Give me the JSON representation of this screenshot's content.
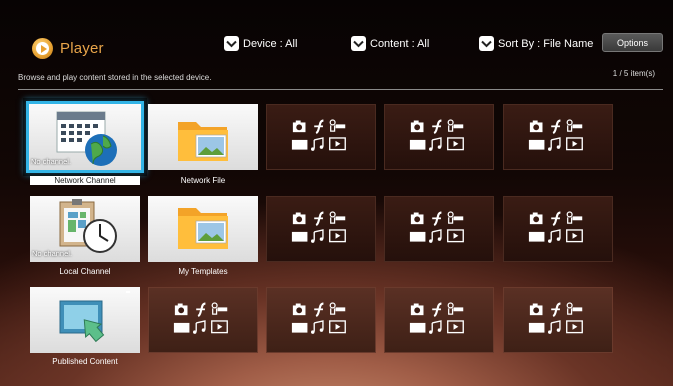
{
  "app": {
    "title": "Player",
    "icon": "play-icon"
  },
  "filters": {
    "device": "Device : All",
    "content": "Content : All",
    "sort": "Sort By : File Name",
    "options": "Options"
  },
  "subtitle": "Browse and play content stored in the selected device.",
  "item_count": "1 / 5 item(s)",
  "tiles": [
    {
      "label": "Network Channel",
      "status": "No channel.",
      "icon": "network-channel-icon",
      "selected": true
    },
    {
      "label": "Network File",
      "icon": "folder-icon"
    },
    {
      "label": "Local Channel",
      "status": "No channel.",
      "icon": "local-channel-icon"
    },
    {
      "label": "My Templates",
      "icon": "folder-icon"
    },
    {
      "label": "Published Content",
      "icon": "published-content-icon"
    }
  ],
  "colors": {
    "accent": "#e9a54a",
    "focus": "#33b4e6",
    "background": "#1a0a07"
  }
}
